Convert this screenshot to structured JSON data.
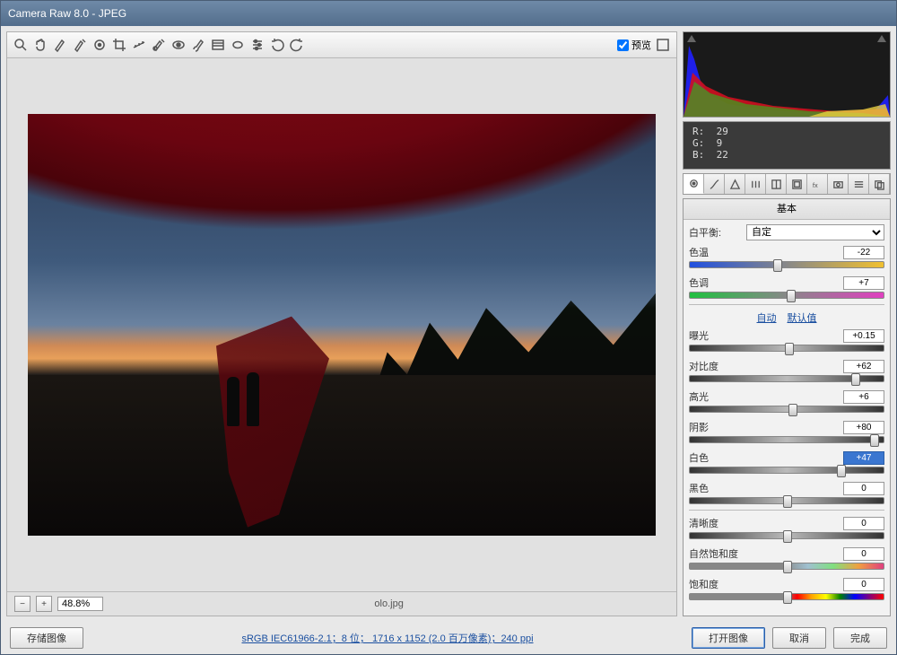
{
  "titlebar": "Camera Raw 8.0  -  JPEG",
  "preview_label": "预览",
  "zoom": "48.8%",
  "filename": "olo.jpg",
  "meta_line": "sRGB IEC61966-2.1；8 位；  1716 x 1152  (2.0 百万像素)；240 ppi",
  "buttons": {
    "save": "存储图像",
    "open": "打开图像",
    "cancel": "取消",
    "done": "完成"
  },
  "rgb": {
    "r_label": "R:",
    "g_label": "G:",
    "b_label": "B:",
    "r": "29",
    "g": "9",
    "b": "22"
  },
  "panel_title": "基本",
  "wb": {
    "label": "白平衡:",
    "value": "自定"
  },
  "links": {
    "auto": "自动",
    "default": "默认值"
  },
  "sliders": {
    "temp": {
      "label": "色温",
      "value": "-22",
      "pos": 45,
      "track": "temp"
    },
    "tint": {
      "label": "色调",
      "value": "+7",
      "pos": 52,
      "track": "tint"
    },
    "exposure": {
      "label": "曝光",
      "value": "+0.15",
      "pos": 51,
      "track": "gray"
    },
    "contrast": {
      "label": "对比度",
      "value": "+62",
      "pos": 85,
      "track": "gray"
    },
    "highlights": {
      "label": "高光",
      "value": "+6",
      "pos": 53,
      "track": "gray"
    },
    "shadows": {
      "label": "阴影",
      "value": "+80",
      "pos": 95,
      "track": "gray"
    },
    "whites": {
      "label": "白色",
      "value": "+47",
      "pos": 78,
      "track": "gray",
      "hl": true
    },
    "blacks": {
      "label": "黑色",
      "value": "0",
      "pos": 50,
      "track": "gray"
    },
    "clarity": {
      "label": "清晰度",
      "value": "0",
      "pos": 50,
      "track": "gray"
    },
    "vibrance": {
      "label": "自然饱和度",
      "value": "0",
      "pos": 50,
      "track": "vib"
    },
    "saturation": {
      "label": "饱和度",
      "value": "0",
      "pos": 50,
      "track": "sat"
    }
  },
  "slider_order": [
    "temp",
    "tint",
    "|",
    "links",
    "exposure",
    "contrast",
    "highlights",
    "shadows",
    "whites",
    "blacks",
    "|",
    "clarity",
    "vibrance",
    "saturation"
  ]
}
